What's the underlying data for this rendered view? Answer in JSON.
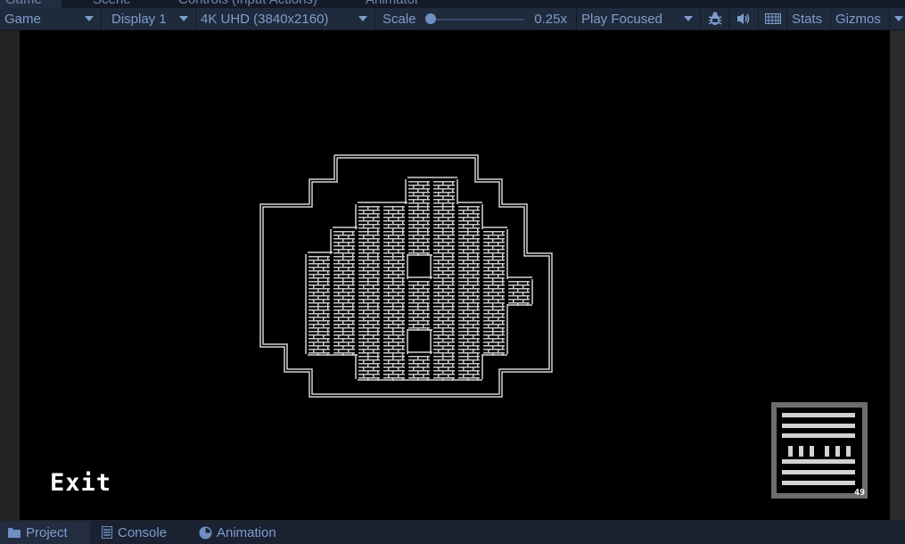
{
  "editor_tabs": [
    {
      "label": "Game",
      "icon": "gamepad-icon",
      "active": true
    },
    {
      "label": "Scene",
      "icon": "grid-icon",
      "active": false
    },
    {
      "label": "Controls (Input Actions)",
      "icon": "",
      "active": false
    },
    {
      "label": "Animator",
      "icon": "animator-icon",
      "active": false
    }
  ],
  "toolbar": {
    "view_mode": "Game",
    "display": "Display 1",
    "resolution": "4K UHD (3840x2160)",
    "scale_label": "Scale",
    "scale_value": "0.25x",
    "scale_fraction": 0.0,
    "play_mode": "Play Focused",
    "bug_icon": "bug-icon",
    "audio_icon": "speaker-icon",
    "keyboard_icon": "keyboard-icon",
    "stats_label": "Stats",
    "gizmos_label": "Gizmos"
  },
  "game": {
    "exit_label": "Exit",
    "minimap_count": "49",
    "colors": {
      "background": "#000000",
      "wall": "#d2d2d2",
      "brick": "#c8c8c8"
    },
    "floor_cells": [
      [
        4,
        0
      ],
      [
        5,
        0
      ],
      [
        2,
        1
      ],
      [
        3,
        1
      ],
      [
        4,
        1
      ],
      [
        5,
        1
      ],
      [
        6,
        1
      ],
      [
        1,
        2
      ],
      [
        2,
        2
      ],
      [
        3,
        2
      ],
      [
        4,
        2
      ],
      [
        5,
        2
      ],
      [
        6,
        2
      ],
      [
        7,
        2
      ],
      [
        0,
        3
      ],
      [
        1,
        3
      ],
      [
        2,
        3
      ],
      [
        3,
        3
      ],
      [
        5,
        3
      ],
      [
        6,
        3
      ],
      [
        7,
        3
      ],
      [
        0,
        4
      ],
      [
        1,
        4
      ],
      [
        2,
        4
      ],
      [
        3,
        4
      ],
      [
        4,
        4
      ],
      [
        5,
        4
      ],
      [
        6,
        4
      ],
      [
        7,
        4
      ],
      [
        8,
        4
      ],
      [
        0,
        5
      ],
      [
        1,
        5
      ],
      [
        2,
        5
      ],
      [
        3,
        5
      ],
      [
        4,
        5
      ],
      [
        5,
        5
      ],
      [
        6,
        5
      ],
      [
        7,
        5
      ],
      [
        0,
        6
      ],
      [
        1,
        6
      ],
      [
        2,
        6
      ],
      [
        3,
        6
      ],
      [
        5,
        6
      ],
      [
        6,
        6
      ],
      [
        7,
        6
      ],
      [
        2,
        7
      ],
      [
        3,
        7
      ],
      [
        4,
        7
      ],
      [
        5,
        7
      ],
      [
        6,
        7
      ]
    ]
  },
  "bottom_tabs": [
    {
      "label": "Project",
      "icon": "folder-icon",
      "active": true
    },
    {
      "label": "Console",
      "icon": "console-icon",
      "active": false
    },
    {
      "label": "Animation",
      "icon": "clock-icon",
      "active": false
    }
  ]
}
